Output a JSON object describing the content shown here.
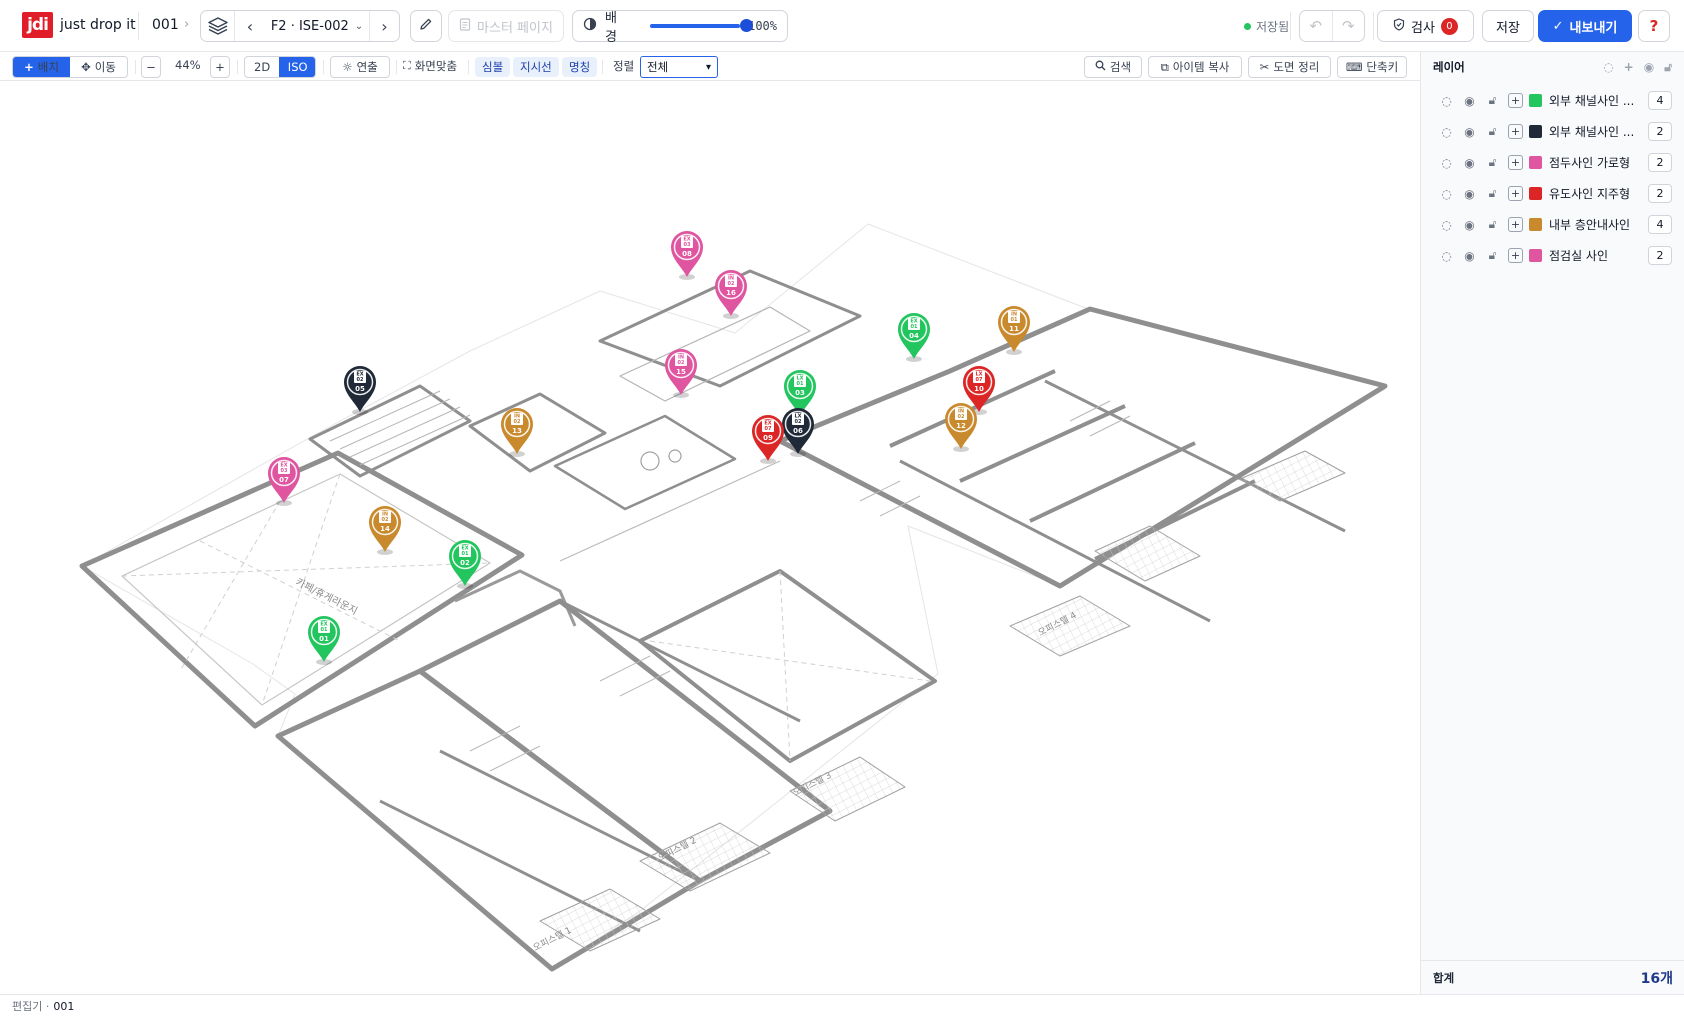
{
  "app": {
    "logo": "jdi",
    "brand": "just drop it"
  },
  "header": {
    "project_code": "001",
    "current_page": "F2 · ISE-002",
    "master_page_label": "마스터 페이지",
    "background_label": "배경",
    "background_opacity": 1.0,
    "background_opacity_text": "100%",
    "saved_label": "저장됨",
    "inspect_label": "검사",
    "inspect_count": "0",
    "save_label": "저장",
    "export_label": "내보내기",
    "help_label": "?"
  },
  "toolbar": {
    "place_label": "배치",
    "move_label": "이동",
    "zoom_minus": "−",
    "zoom_value": "44%",
    "zoom_plus": "+",
    "view_2d": "2D",
    "view_iso": "ISO",
    "effect_label": "연출",
    "fit_label": "화면맞춤",
    "symbol_tag": "심볼",
    "direction_tag": "지시선",
    "name_tag": "명칭",
    "sort_label": "정렬",
    "sort_value": "전체",
    "search_label": "검색",
    "copy_item_label": "아이템 복사",
    "cleanup_label": "도면 정리",
    "shortcut_label": "단축키"
  },
  "panel": {
    "title": "레이어",
    "layers": [
      {
        "name": "외부 채널사인 ...",
        "color": "#22c55e",
        "count": "4"
      },
      {
        "name": "외부 채널사인 ...",
        "color": "#1f2937",
        "count": "2"
      },
      {
        "name": "점두사인 가로형",
        "color": "#e0559f",
        "count": "2"
      },
      {
        "name": "유도사인 지주형",
        "color": "#dc2626",
        "count": "2"
      },
      {
        "name": "내부 층안내사인",
        "color": "#c98a2e",
        "count": "4"
      },
      {
        "name": "점검실 사인",
        "color": "#e0559f",
        "count": "2"
      }
    ],
    "total_label": "합계",
    "total_value": "16개"
  },
  "floorplan_labels": [
    "오피스텔 1",
    "오피스텔 2",
    "오피스텔 3",
    "오피스텔 4",
    "카페/휴게라운지"
  ],
  "markers": [
    {
      "code": "EX",
      "sub": "01",
      "num": "01",
      "color": "#22c55e"
    },
    {
      "code": "EX",
      "sub": "01",
      "num": "02",
      "color": "#22c55e"
    },
    {
      "code": "LX",
      "sub": "01",
      "num": "03",
      "color": "#22c55e"
    },
    {
      "code": "EX",
      "sub": "01",
      "num": "04",
      "color": "#22c55e"
    },
    {
      "code": "EX",
      "sub": "02",
      "num": "05",
      "color": "#1f2937"
    },
    {
      "code": "LX",
      "sub": "02",
      "num": "06",
      "color": "#1f2937"
    },
    {
      "code": "EX",
      "sub": "03",
      "num": "07",
      "color": "#e0559f"
    },
    {
      "code": "EX",
      "sub": "03",
      "num": "08",
      "color": "#e0559f"
    },
    {
      "code": "EX",
      "sub": "07",
      "num": "09",
      "color": "#dc2626"
    },
    {
      "code": "LX",
      "sub": "07",
      "num": "10",
      "color": "#dc2626"
    },
    {
      "code": "IN",
      "sub": "01",
      "num": "11",
      "color": "#c98a2e"
    },
    {
      "code": "IN",
      "sub": "02",
      "num": "12",
      "color": "#c98a2e"
    },
    {
      "code": "IN",
      "sub": "02",
      "num": "13",
      "color": "#c98a2e"
    },
    {
      "code": "IN",
      "sub": "02",
      "num": "14",
      "color": "#c98a2e"
    },
    {
      "code": "IN",
      "sub": "02",
      "num": "15",
      "color": "#e0559f"
    },
    {
      "code": "IN",
      "sub": "02",
      "num": "16",
      "color": "#e0559f"
    }
  ],
  "status": {
    "label": "편집기 ·",
    "value": "001"
  }
}
